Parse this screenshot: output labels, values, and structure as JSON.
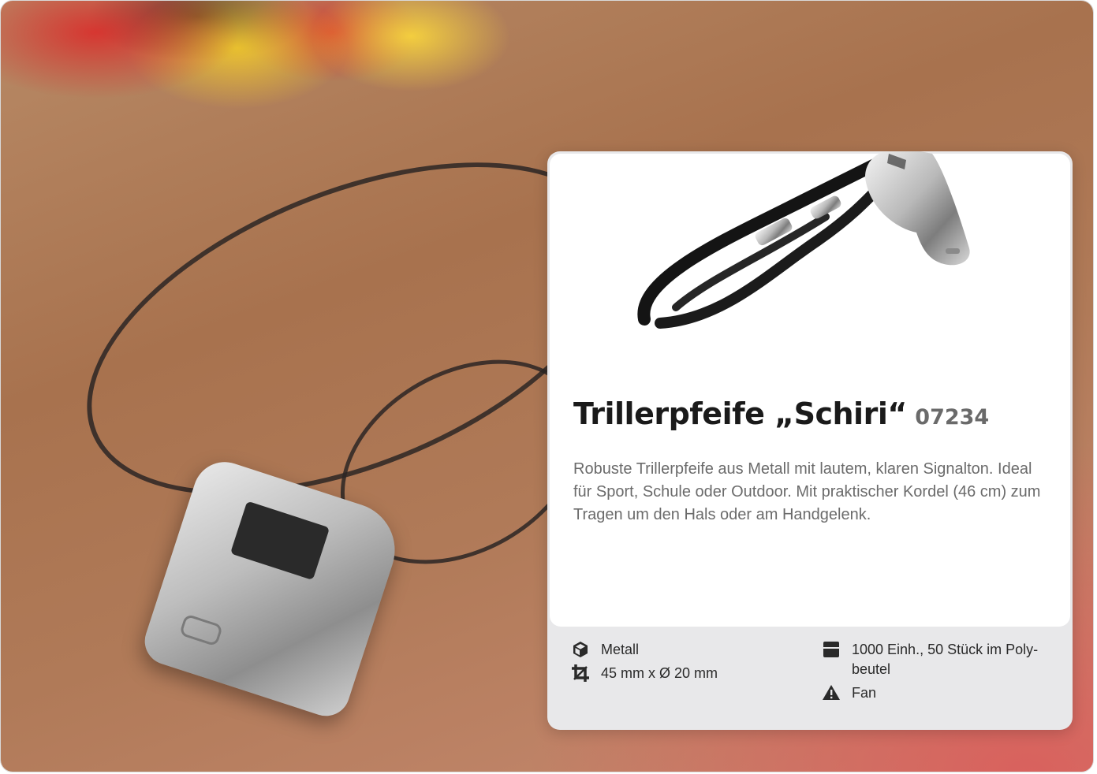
{
  "product": {
    "title": "Trillerpfeife „Schiri“",
    "sku": "07234",
    "description": "Robuste Trillerpfeife aus Metall mit lautem, klaren Signalton. Ideal für Sport, Schule oder Outdoor. Mit praktischer Kordel (46 cm) zum Tragen um den Hals oder am Handgelenk."
  },
  "specs": {
    "material": {
      "icon": "cube-icon",
      "value": "Metall"
    },
    "dimensions": {
      "icon": "crop-icon",
      "value": "45 mm x Ø 20 mm"
    },
    "packaging": {
      "icon": "box-icon",
      "value": "1000 Einh., 50 Stück im Poly-beutel"
    },
    "category": {
      "icon": "warning-icon",
      "value": "Fan"
    }
  },
  "colors": {
    "title": "#1a1a1a",
    "sku": "#6a6a6a",
    "description": "#6b6b6b",
    "spec_panel": "#e8e8ea"
  }
}
